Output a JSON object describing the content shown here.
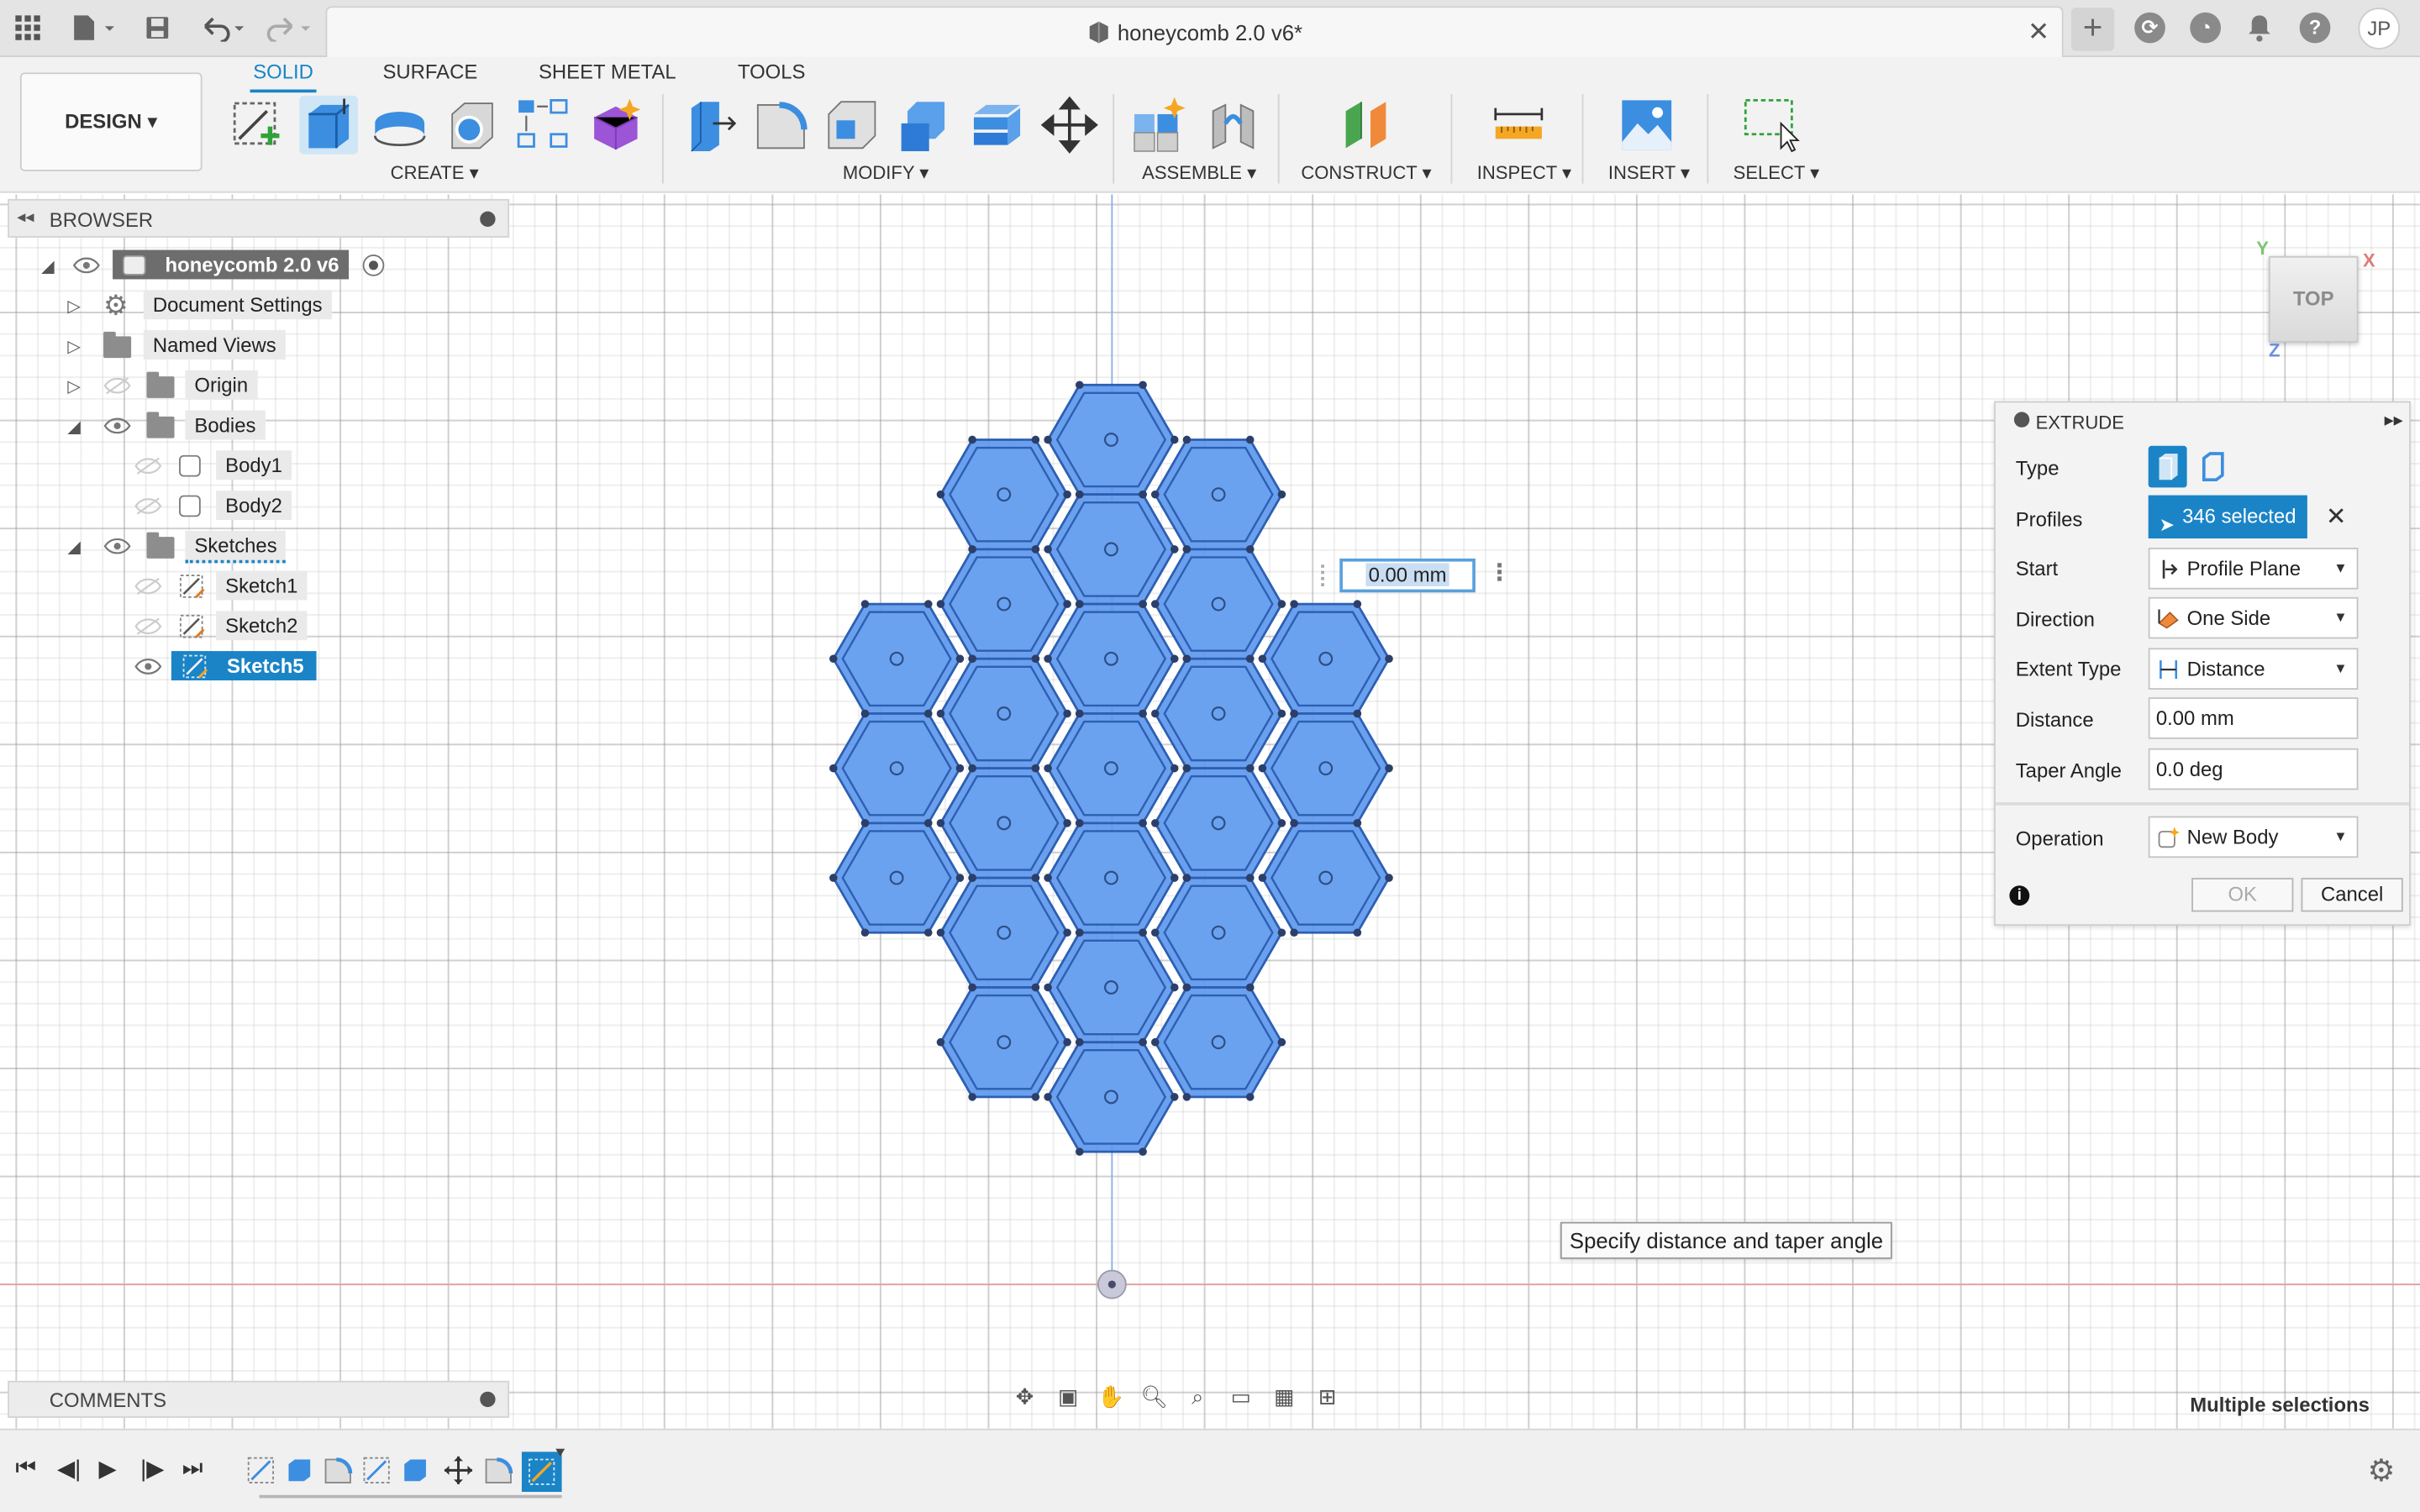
{
  "document": {
    "title": "honeycomb 2.0 v6*"
  },
  "toolbar": {
    "workspace": "DESIGN",
    "tabs": [
      "SOLID",
      "SURFACE",
      "SHEET METAL",
      "TOOLS"
    ],
    "active_tab": "SOLID",
    "groups": [
      "CREATE",
      "MODIFY",
      "ASSEMBLE",
      "CONSTRUCT",
      "INSPECT",
      "INSERT",
      "SELECT"
    ]
  },
  "user": {
    "initials": "JP"
  },
  "browser": {
    "title": "BROWSER",
    "root": "honeycomb 2.0 v6",
    "items": [
      {
        "label": "Document Settings"
      },
      {
        "label": "Named Views"
      },
      {
        "label": "Origin"
      },
      {
        "label": "Bodies"
      },
      {
        "label": "Body1"
      },
      {
        "label": "Body2"
      },
      {
        "label": "Sketches"
      },
      {
        "label": "Sketch1"
      },
      {
        "label": "Sketch2"
      },
      {
        "label": "Sketch5"
      }
    ],
    "selected": "Sketch5"
  },
  "comments": {
    "title": "COMMENTS"
  },
  "canvas": {
    "dimension_input": "0.00 mm",
    "tooltip": "Specify distance and taper angle",
    "status": "Multiple selections",
    "viewcube": {
      "face": "TOP",
      "axes": [
        "Y",
        "X",
        "Z"
      ]
    }
  },
  "extrude": {
    "title": "EXTRUDE",
    "labels": {
      "type": "Type",
      "profiles": "Profiles",
      "start": "Start",
      "direction": "Direction",
      "extent_type": "Extent Type",
      "distance": "Distance",
      "taper_angle": "Taper Angle",
      "operation": "Operation"
    },
    "values": {
      "profiles": "346 selected",
      "start": "Profile Plane",
      "direction": "One Side",
      "extent_type": "Distance",
      "distance": "0.00 mm",
      "taper_angle": "0.0 deg",
      "operation": "New Body"
    },
    "buttons": {
      "ok": "OK",
      "cancel": "Cancel"
    }
  },
  "colors": {
    "accent": "#1a84c7",
    "hex_fill": "#5a96ec",
    "hex_edge": "#2c5fb3"
  }
}
